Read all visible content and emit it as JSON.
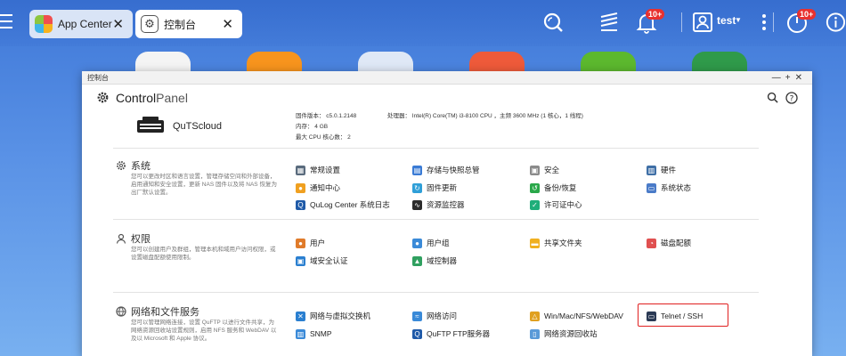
{
  "tabs": [
    {
      "label": "App Center",
      "icon": "app-center-icon"
    },
    {
      "label": "控制台",
      "icon": "gear-icon"
    }
  ],
  "topbar": {
    "notification_badge": "10+",
    "user": "test",
    "status_badge": "10+"
  },
  "window": {
    "title": "控制台",
    "app_title_bold": "Control",
    "app_title_light": "Panel"
  },
  "device": {
    "name": "QuTScloud",
    "firmware": "固件版本： c5.0.1.2148",
    "memory": "内存： 4 GB",
    "max_cpu": "最大 CPU 核心数： 2",
    "processor": "处理器： Intel(R) Core(TM) i3-8100 CPU ，主频 3600 MHz (1 核心，1 线程)"
  },
  "sections": [
    {
      "title": "系统",
      "icon": "gear-icon",
      "desc": "您可以更改时区和语言设置，管理存储空间和外部设备，启用通知和安全设置，更新 NAS 固件以及将 NAS 恢复为出厂默认设置。",
      "items": [
        {
          "label": "常规设置",
          "icon": "general-settings-icon",
          "color": "#5a6b7d"
        },
        {
          "label": "存储与快照总管",
          "icon": "storage-icon",
          "color": "#3a7bd5"
        },
        {
          "label": "安全",
          "icon": "lock-icon",
          "color": "#8a8a8a"
        },
        {
          "label": "硬件",
          "icon": "hardware-icon",
          "color": "#3f6fa6"
        },
        {
          "label": "通知中心",
          "icon": "notification-icon",
          "color": "#f0a020"
        },
        {
          "label": "固件更新",
          "icon": "firmware-icon",
          "color": "#2f9fd8"
        },
        {
          "label": "备份/恢复",
          "icon": "backup-icon",
          "color": "#2aa84a"
        },
        {
          "label": "系统状态",
          "icon": "status-icon",
          "color": "#4a7bc8"
        },
        {
          "label": "QuLog Center 系统日志",
          "icon": "qulog-icon",
          "color": "#1f5aa8"
        },
        {
          "label": "资源监控器",
          "icon": "monitor-icon",
          "color": "#2b2b2b"
        },
        {
          "label": "许可证中心",
          "icon": "license-icon",
          "color": "#1fae7a"
        }
      ]
    },
    {
      "title": "权限",
      "icon": "user-icon",
      "desc": "您可以创建用户及群组，管理本机和域用户访问权限，或设置磁盘配额使用限制。",
      "items": [
        {
          "label": "用户",
          "icon": "user-icon",
          "color": "#e07b2a"
        },
        {
          "label": "用户组",
          "icon": "group-icon",
          "color": "#3a8ad8"
        },
        {
          "label": "共享文件夹",
          "icon": "folder-icon",
          "color": "#f0b020"
        },
        {
          "label": "磁盘配额",
          "icon": "quota-icon",
          "color": "#e05050"
        },
        {
          "label": "域安全认证",
          "icon": "domain-auth-icon",
          "color": "#2a7fd0"
        },
        {
          "label": "域控制器",
          "icon": "domain-controller-icon",
          "color": "#30a060"
        }
      ]
    },
    {
      "title": "网络和文件服务",
      "icon": "globe-icon",
      "desc": "您可以管理网络连接，设置 QuFTP 以进行文件共享，为网络资源回收站设置规则，启用 NFS 服务和 WebDAV 以及以 Microsoft 和 Apple 协议。",
      "items": [
        {
          "label": "网络与虚拟交换机",
          "icon": "network-switch-icon",
          "color": "#2a7fd0"
        },
        {
          "label": "网络访问",
          "icon": "network-access-icon",
          "color": "#3a8ad8"
        },
        {
          "label": "Win/Mac/NFS/WebDAV",
          "icon": "protocol-icon",
          "color": "#e0a020"
        },
        {
          "label": "Telnet / SSH",
          "icon": "terminal-icon",
          "color": "#2b3a55"
        },
        {
          "label": "SNMP",
          "icon": "snmp-icon",
          "color": "#3a8ad8"
        },
        {
          "label": "QuFTP FTP服务器",
          "icon": "ftp-icon",
          "color": "#1f5aa8"
        },
        {
          "label": "网络资源回收站",
          "icon": "recycle-bin-icon",
          "color": "#5a9ad8"
        }
      ]
    }
  ]
}
